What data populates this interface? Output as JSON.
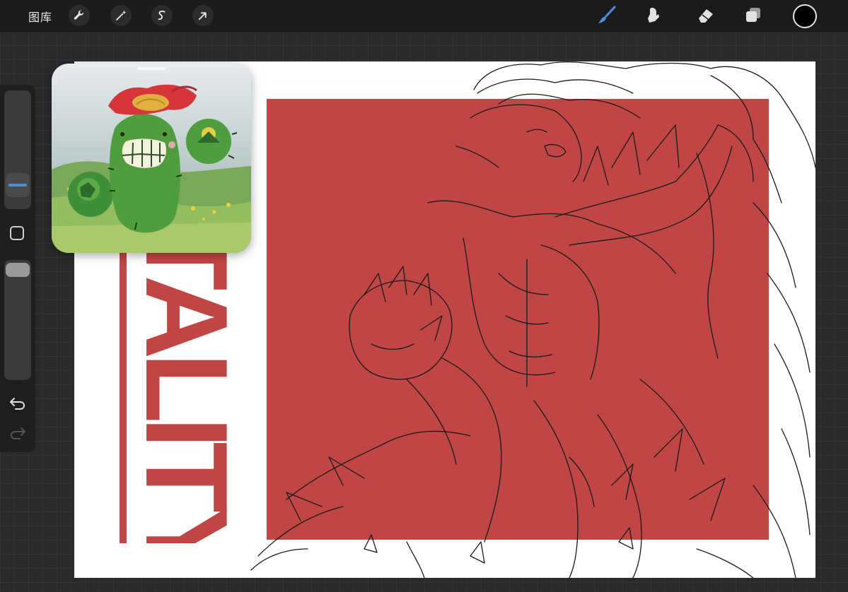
{
  "toolbar": {
    "gallery_label": "图库",
    "left_tools": [
      "wrench-icon",
      "magic-wand-icon",
      "selection-icon",
      "transform-arrow-icon"
    ],
    "right_tools": [
      "brush-icon",
      "smudge-icon",
      "eraser-icon",
      "layers-icon"
    ],
    "active_tool": "brush",
    "accent_color": "#4a90e2",
    "current_color": "#000000"
  },
  "sidebar": {
    "brush_size": 0.77,
    "opacity": 1.0
  },
  "canvas": {
    "title_text": "TALITY",
    "panel_color": "#c04545",
    "background": "#ffffff"
  },
  "reference": {
    "icon": "cactus-character-image"
  }
}
